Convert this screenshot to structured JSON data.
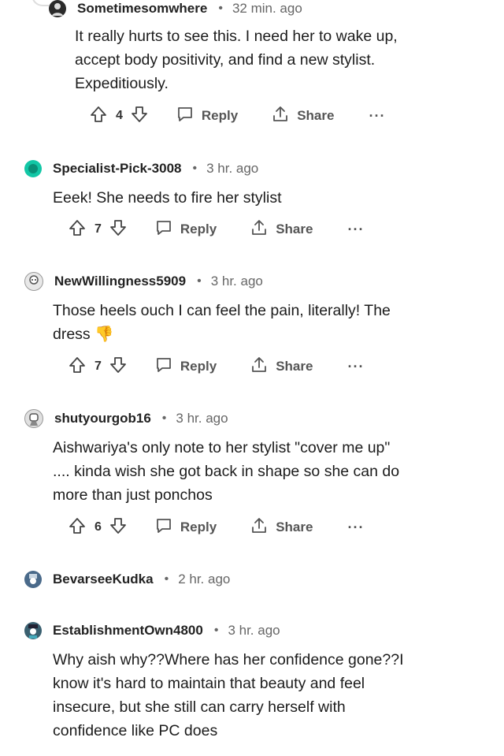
{
  "comments": [
    {
      "user": "Sometimesomwhere",
      "time": "32 min. ago",
      "lines": [
        "It really hurts to see this. I need her to wake up,",
        "accept body positivity, and find a new stylist.",
        "Expeditiously."
      ],
      "votes": "4",
      "avatar_color": "#2b2b2b"
    },
    {
      "user": "Specialist-Pick-3008",
      "time": "3 hr. ago",
      "lines": [
        "Eeek! She needs to fire her stylist"
      ],
      "votes": "7",
      "avatar_color": "#12c7a6"
    },
    {
      "user": "NewWillingness5909",
      "time": "3 hr. ago",
      "lines": [
        "Those heels ouch I can feel the pain, literally! The",
        "dress 👎"
      ],
      "votes": "7",
      "avatar_color": "#8a8a8a"
    },
    {
      "user": "shutyourgob16",
      "time": "3 hr. ago",
      "lines": [
        "Aishwariya's only note to her stylist \"cover me up\"",
        ".... kinda wish she got back in shape so she can do",
        "more than just ponchos"
      ],
      "votes": "6",
      "avatar_color": "#9a9a9a"
    },
    {
      "user": "BevarseeKudka",
      "time": "2 hr. ago",
      "lines": [],
      "votes": "",
      "avatar_color": "#4a6a8a"
    },
    {
      "user": "EstablishmentOwn4800",
      "time": "3 hr. ago",
      "lines": [
        "Why aish why??Where has her confidence gone??I",
        "know it's hard to maintain that beauty and feel",
        "insecure, but she still can carry herself with",
        "confidence like PC does"
      ],
      "votes": "",
      "avatar_color": "#3a6070"
    }
  ],
  "labels": {
    "reply": "Reply",
    "share": "Share",
    "more": "···",
    "separator": "•"
  },
  "icons": {
    "upvote": "upvote-arrow-icon",
    "downvote": "downvote-arrow-icon",
    "reply": "speech-bubble-icon",
    "share": "share-upload-icon"
  }
}
